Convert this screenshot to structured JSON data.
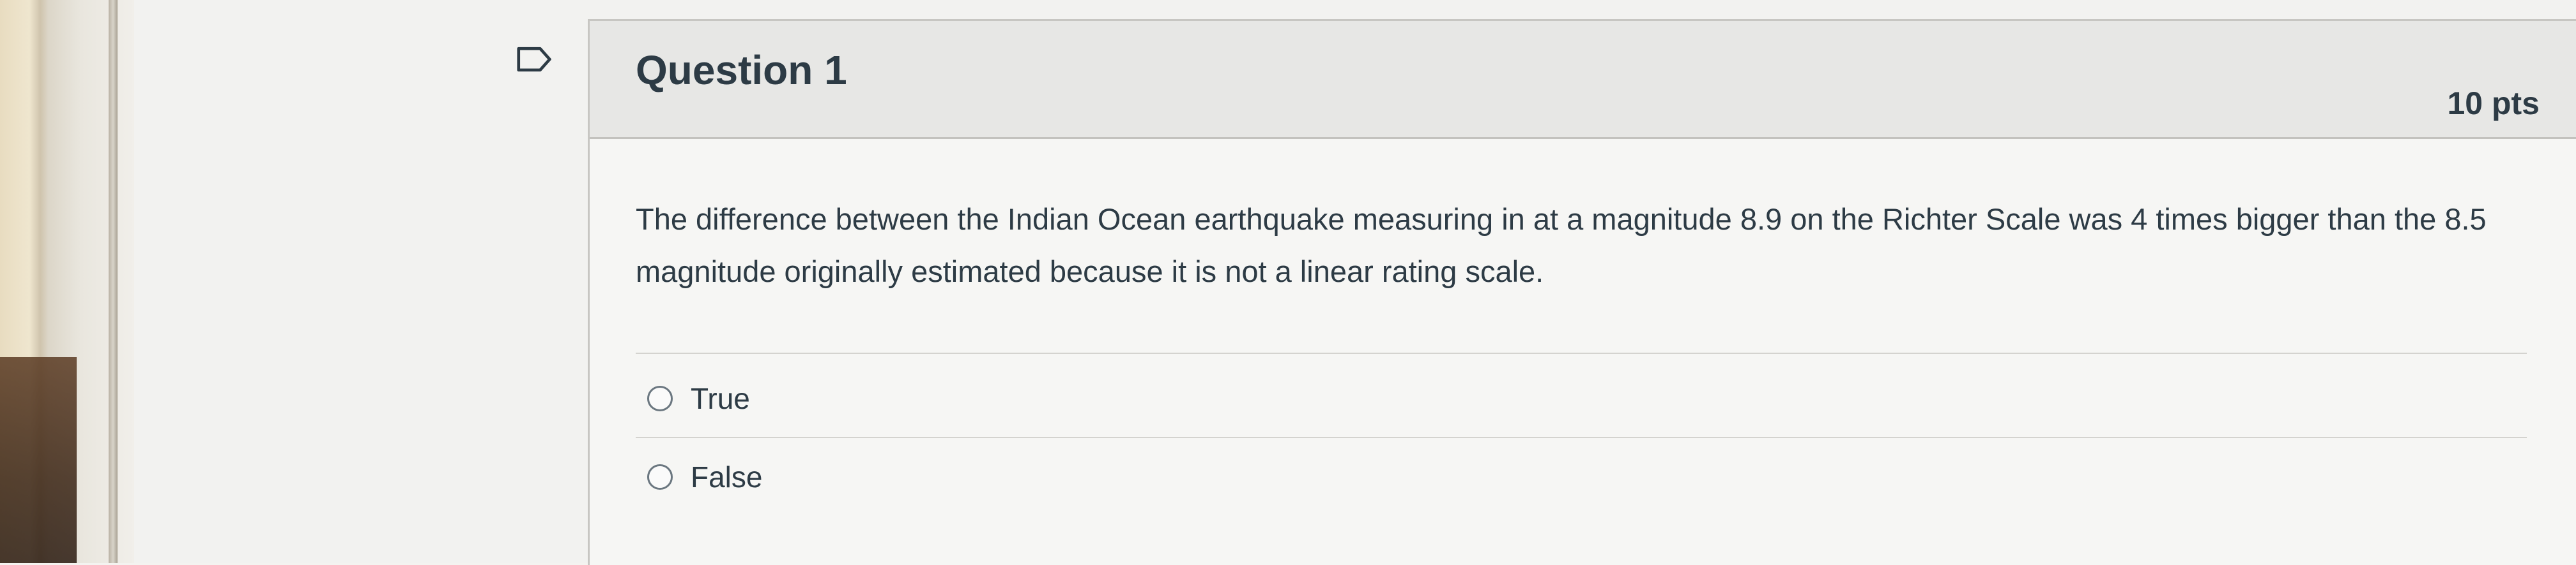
{
  "question": {
    "title": "Question 1",
    "points": "10 pts",
    "text": "The difference between the Indian Ocean earthquake measuring in at a magnitude 8.9 on the Richter Scale was 4 times bigger than the 8.5 magnitude originally estimated because it is not a linear rating scale.",
    "answers": [
      {
        "label": "True",
        "selected": false
      },
      {
        "label": "False",
        "selected": false
      }
    ]
  },
  "icons": {
    "bookmark": "bookmark-flag-icon",
    "radio": "radio-button-icon"
  },
  "colors": {
    "text": "#2d3b45",
    "header_bg": "#e7e7e5",
    "card_bg": "#f6f6f4",
    "border": "#c7c6c2"
  }
}
